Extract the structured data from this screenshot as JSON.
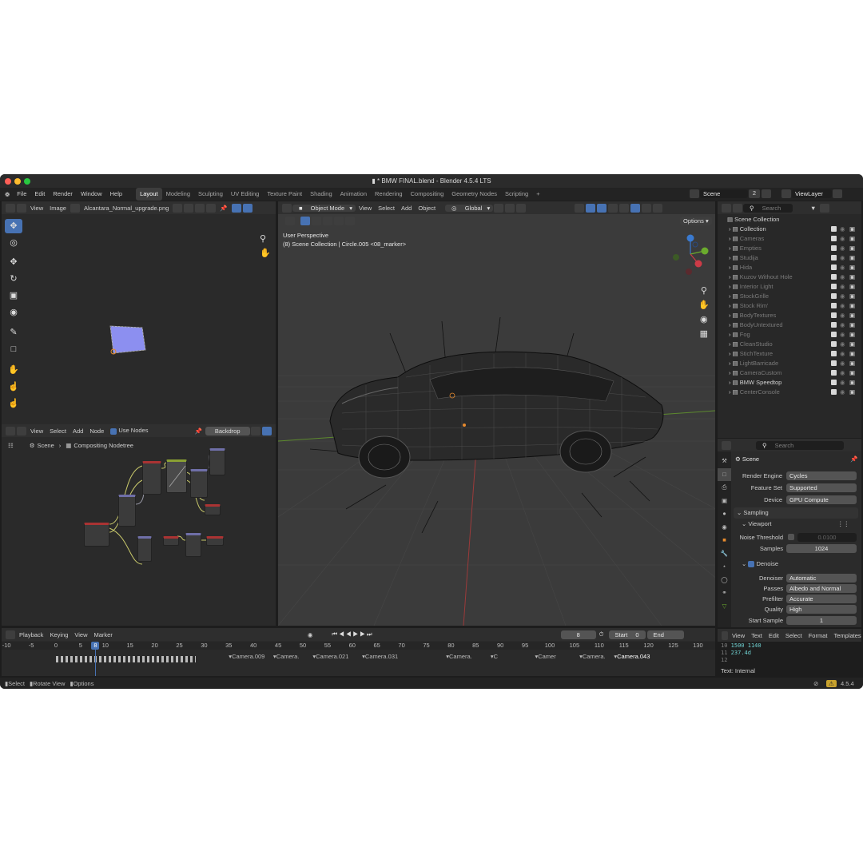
{
  "window": {
    "title": "* BMW FINAL.blend - Blender 4.5.4 LTS"
  },
  "menu": [
    "File",
    "Edit",
    "Render",
    "Window",
    "Help"
  ],
  "workspaces": [
    "Layout",
    "Modeling",
    "Sculpting",
    "UV Editing",
    "Texture Paint",
    "Shading",
    "Animation",
    "Rendering",
    "Compositing",
    "Geometry Nodes",
    "Scripting"
  ],
  "scene": {
    "name": "Scene",
    "count": "2",
    "view_layer": "ViewLayer"
  },
  "image_editor": {
    "menus": [
      "View",
      "Image"
    ],
    "image_name": "Alcantara_Normal_upgrade.png"
  },
  "node_editor": {
    "menus": [
      "View",
      "Select",
      "Add",
      "Node"
    ],
    "use_nodes": "Use Nodes",
    "backdrop": "Backdrop",
    "breadcrumb_scene": "Scene",
    "breadcrumb_tree": "Compositing Nodetree"
  },
  "viewport": {
    "mode": "Object Mode",
    "menus": [
      "View",
      "Select",
      "Add",
      "Object"
    ],
    "transform": "Global",
    "options": "Options",
    "perspective": "User Perspective",
    "info": "(8) Scene Collection | Circle.005 <08_marker>"
  },
  "outliner": {
    "search": "Search",
    "root": "Scene Collection",
    "items": [
      "Collection",
      "Cameras",
      "Empties",
      "Studija",
      "Hida",
      "Kuzov Without Hole",
      "Interior Light",
      "StockGrille",
      "Stock Rim'",
      "BodyTextures",
      "BodyUntextured",
      "Fog",
      "CleanStudio",
      "StichTexture",
      "LightBarricade",
      "CameraCustom",
      "BMW Speedtop",
      "CenterConsole"
    ]
  },
  "properties": {
    "search": "Search",
    "title": "Scene",
    "render_engine_label": "Render Engine",
    "render_engine": "Cycles",
    "feature_set_label": "Feature Set",
    "feature_set": "Supported",
    "device_label": "Device",
    "device": "GPU Compute",
    "sampling": "Sampling",
    "viewport": "Viewport",
    "noise_label": "Noise Threshold",
    "noise": "0.0100",
    "samples_label": "Samples",
    "samples": "1024",
    "denoise": "Denoise",
    "denoiser_label": "Denoiser",
    "denoiser": "Automatic",
    "passes_label": "Passes",
    "passes": "Albedo and Normal",
    "prefilter_label": "Prefilter",
    "prefilter": "Accurate",
    "quality_label": "Quality",
    "quality": "High",
    "start_sample_label": "Start Sample",
    "start_sample": "1"
  },
  "timeline": {
    "menus": [
      "Playback",
      "Keying",
      "View",
      "Marker"
    ],
    "current": "8",
    "start_label": "Start",
    "start": "0",
    "end_label": "End",
    "end": "1558",
    "ticks": [
      "-10",
      "-5",
      "0",
      "5",
      "10",
      "15",
      "20",
      "25",
      "30",
      "35",
      "40",
      "45",
      "50",
      "55",
      "60",
      "65",
      "70",
      "75",
      "80",
      "85",
      "90",
      "95",
      "100",
      "105",
      "110",
      "115",
      "120",
      "125",
      "130"
    ],
    "markers": [
      "Camera.009",
      "Camera.",
      "Camera.021",
      "Camera.031",
      "Camera.",
      "C",
      "Camer",
      "Camera.",
      "Camera.043"
    ]
  },
  "text_editor": {
    "menus": [
      "View",
      "Text",
      "Edit",
      "Select",
      "Format",
      "Templates"
    ],
    "lines": [
      {
        "n": "10",
        "t": "1500  1140"
      },
      {
        "n": "11",
        "t": "237.4d"
      },
      {
        "n": "12",
        "t": ""
      }
    ],
    "footer": "Text: Internal"
  },
  "status": {
    "items": [
      "Select",
      "Rotate View",
      "Options"
    ],
    "version": "4.5.4"
  }
}
